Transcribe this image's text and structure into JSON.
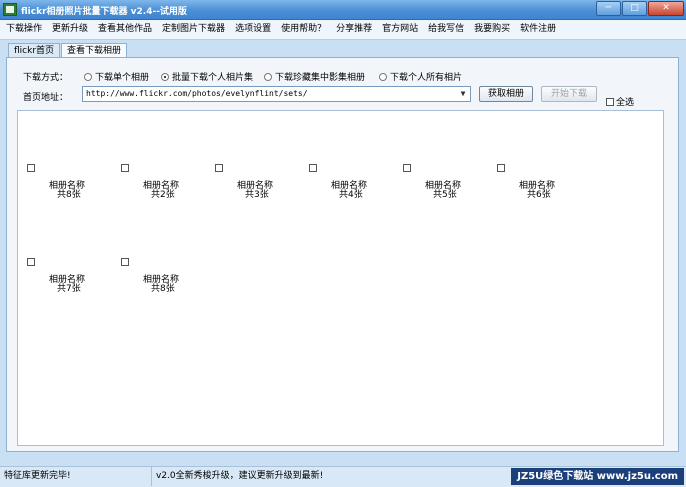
{
  "window": {
    "title": "flickr相册照片批量下载器 v2.4--试用版",
    "buttons": {
      "minimize": "─",
      "maximize": "□",
      "close": "✕"
    }
  },
  "menu": [
    "下载操作",
    "更新升级",
    "查看其他作品",
    "定制图片下载器",
    "选项设置",
    "使用帮助？",
    "分享推荐",
    "官方网站",
    "给我写信",
    "我要购买",
    "软件注册"
  ],
  "tabs": [
    {
      "label": "flickr首页",
      "active": false
    },
    {
      "label": "查看下载相册",
      "active": true
    }
  ],
  "form": {
    "mode_label": "下载方式：",
    "modes": [
      {
        "label": "下载单个相册",
        "selected": false
      },
      {
        "label": "批量下载个人相片集",
        "selected": true
      },
      {
        "label": "下载珍藏集中影集相册",
        "selected": false
      },
      {
        "label": "下载个人所有相片",
        "selected": false
      }
    ],
    "url_label": "首页地址：",
    "url_value": "http://www.flickr.com/photos/evelynflint/sets/",
    "fetch_button": "获取相册",
    "download_button": "开始下载",
    "select_all": "全选"
  },
  "albums": [
    {
      "name": "相册名称",
      "count": "共8张"
    },
    {
      "name": "相册名称",
      "count": "共2张"
    },
    {
      "name": "相册名称",
      "count": "共3张"
    },
    {
      "name": "相册名称",
      "count": "共4张"
    },
    {
      "name": "相册名称",
      "count": "共5张"
    },
    {
      "name": "相册名称",
      "count": "共6张"
    },
    {
      "name": "相册名称",
      "count": "共7张"
    },
    {
      "name": "相册名称",
      "count": "共8张"
    }
  ],
  "status": {
    "left": "特征库更新完毕!",
    "right": "v2.0全新秀梭升级，建议更新升级到最新!",
    "watermark": "JZ5U绿色下载站 www.jz5u.com"
  },
  "colors": {
    "titlebar": "#4b8fd5",
    "accent": "#1a3f7a",
    "panel": "#f2f6fb"
  }
}
